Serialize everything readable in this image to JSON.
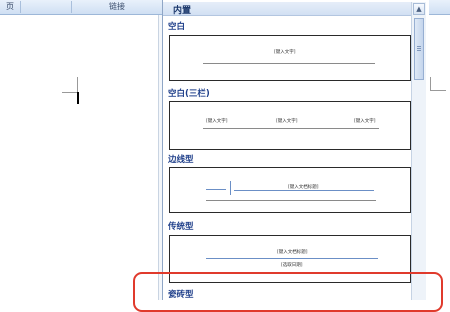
{
  "ribbon": {
    "groups": [
      "页",
      "",
      "链接",
      ""
    ]
  },
  "gallery": {
    "header": "内置",
    "sections": [
      {
        "title": "空白",
        "placeholders": [
          "[键入文字]"
        ]
      },
      {
        "title": "空白(三栏)",
        "placeholders": [
          "[键入文字]",
          "[键入文字]",
          "[键入文字]"
        ]
      },
      {
        "title": "边线型",
        "placeholders": [
          "[键入文档标题]"
        ]
      },
      {
        "title": "传统型",
        "placeholders": [
          "[键入文档标题]",
          "[选取日期]"
        ]
      },
      {
        "title": "瓷砖型",
        "placeholders": []
      }
    ],
    "highlighted_item": "瓷砖型"
  },
  "colors": {
    "section_title": "#1f3f8a",
    "highlight": "#e03a2c",
    "ribbon": "#cfdff3"
  },
  "scrollbar": {
    "up_icon": "arrow-up-icon",
    "down_icon": "arrow-down-icon"
  }
}
